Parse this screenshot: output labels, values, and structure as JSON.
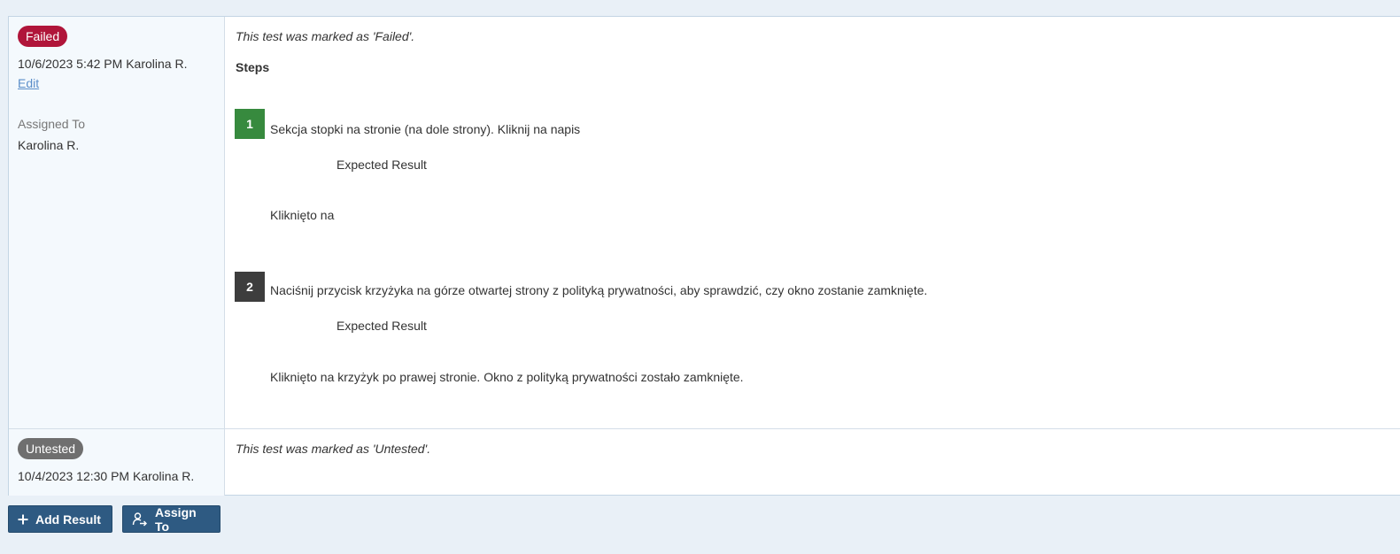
{
  "results": [
    {
      "status": "Failed",
      "timestamp_user": "10/6/2023 5:42 PM Karolina R.",
      "edit_label": "Edit",
      "assigned_label": "Assigned To",
      "assigned_value": "Karolina R.",
      "comment": "This test was marked as 'Failed'.",
      "steps_heading": "Steps",
      "steps": [
        {
          "number": "1",
          "status": "passed",
          "text": "Sekcja stopki na stronie (na dole strony). Kliknij na napis",
          "expected_label": "Expected Result",
          "expected_text": "Kliknięto na"
        },
        {
          "number": "2",
          "status": "failed",
          "text": "Naciśnij przycisk krzyżyka na górze otwartej strony z polityką prywatności, aby sprawdzić, czy okno zostanie zamknięte.",
          "expected_label": "Expected Result",
          "expected_text": "Kliknięto na krzyżyk po prawej stronie. Okno z polityką prywatności zostało zamknięte."
        }
      ]
    },
    {
      "status": "Untested",
      "timestamp_user": "10/4/2023 12:30 PM Karolina R.",
      "comment": "This test was marked as 'Untested'."
    }
  ],
  "actions": {
    "add_result_label": "Add Result",
    "add_result_icon": "plus-icon",
    "assign_to_label": "Assign To",
    "assign_to_icon": "assign-user-icon"
  },
  "colors": {
    "failed": "#b0153a",
    "untested": "#6f6f6f",
    "step_passed": "#378a3e",
    "step_failed": "#3d3d3d",
    "button": "#2e5a82",
    "link": "#5b8ec9"
  }
}
